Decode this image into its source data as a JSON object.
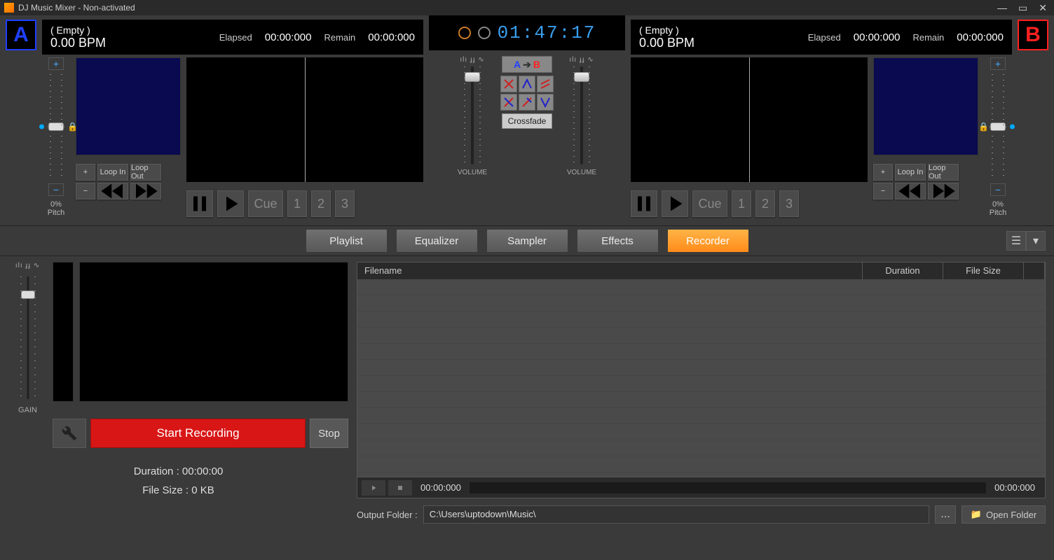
{
  "titlebar": {
    "title": "DJ Music Mixer - Non-activated"
  },
  "clock": "01:47:17",
  "deckA": {
    "badge": "A",
    "title": "( Empty )",
    "bpm": "0.00 BPM",
    "elapsed_lbl": "Elapsed",
    "elapsed": "00:00:000",
    "remain_lbl": "Remain",
    "remain": "00:00:000",
    "pitch_pct": "0%",
    "pitch_lbl": "Pitch",
    "loop_in": "Loop In",
    "loop_out": "Loop Out",
    "loop_num": "1",
    "cue": "Cue",
    "n1": "1",
    "n2": "2",
    "n3": "3"
  },
  "deckB": {
    "badge": "B",
    "title": "( Empty )",
    "bpm": "0.00 BPM",
    "elapsed_lbl": "Elapsed",
    "elapsed": "00:00:000",
    "remain_lbl": "Remain",
    "remain": "00:00:000",
    "pitch_pct": "0%",
    "pitch_lbl": "Pitch",
    "loop_in": "Loop In",
    "loop_out": "Loop Out",
    "loop_num": "1",
    "cue": "Cue",
    "n1": "1",
    "n2": "2",
    "n3": "3"
  },
  "center": {
    "volume_lbl": "VOLUME",
    "crossfade": "Crossfade"
  },
  "tabs": {
    "playlist": "Playlist",
    "equalizer": "Equalizer",
    "sampler": "Sampler",
    "effects": "Effects",
    "recorder": "Recorder"
  },
  "recorder": {
    "gain_lbl": "GAIN",
    "start": "Start Recording",
    "stop": "Stop",
    "duration_lbl": "Duration : 00:00:00",
    "filesize_lbl": "File Size : 0 KB",
    "cols": {
      "filename": "Filename",
      "duration": "Duration",
      "filesize": "File Size"
    },
    "play_elapsed": "00:00:000",
    "play_total": "00:00:000",
    "output_lbl": "Output Folder :",
    "output_path": "C:\\Users\\uptodown\\Music\\",
    "open_folder": "Open Folder",
    "browse": "..."
  }
}
